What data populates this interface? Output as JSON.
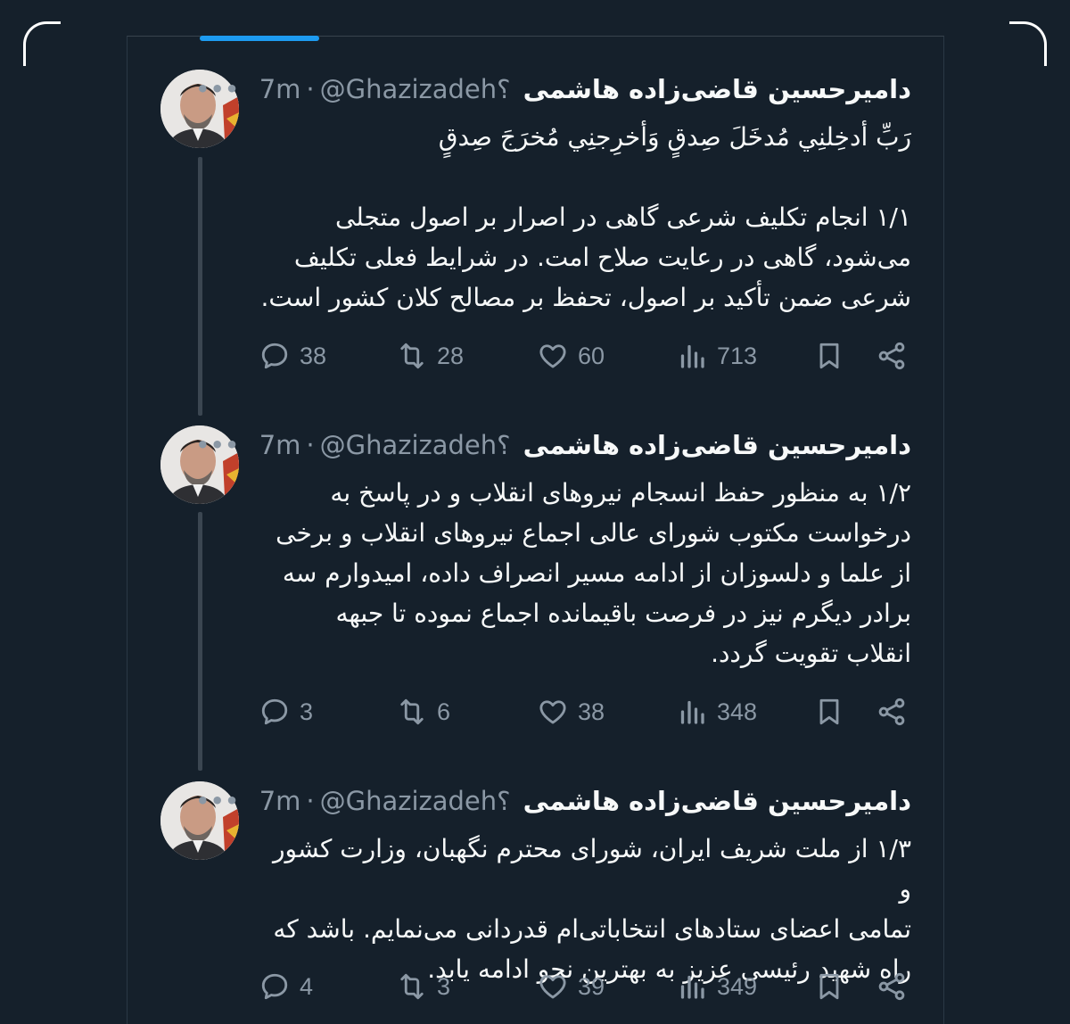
{
  "tweets": [
    {
      "name": "دامیرحسین قاضی‌زاده هاشمی",
      "handle": "@Ghazizadeh؟",
      "time": "7m",
      "more": "•••",
      "lines": [
        "رَبِّ أدخِلنِي مُدخَلَ صِدقٍ وَأخرِجنِي مُخرَجَ صِدقٍ",
        "",
        "۱/۱ انجام تکلیف شرعی گاهی در اصرار بر اصول متجلی",
        "می‌شود، گاهی در رعایت صلاح امت. در شرایط فعلی تکلیف",
        "شرعی ضمن تأکید بر اصول، تحفظ بر مصالح کلان کشور است."
      ],
      "replies": "38",
      "retweets": "28",
      "likes": "60",
      "views": "713"
    },
    {
      "name": "دامیرحسین قاضی‌زاده هاشمی",
      "handle": "@Ghazizadeh؟",
      "time": "7m",
      "more": "•••",
      "lines": [
        "۱/۲ به منظور حفظ انسجام نیروهای انقلاب و در پاسخ به",
        "درخواست مکتوب شورای عالی اجماع نیروهای انقلاب و برخی",
        "از علما و دلسوزان از ادامه مسیر انصراف داده، امیدوارم سه",
        "برادر دیگرم نیز در فرصت باقیمانده اجماع نموده تا جبهه",
        "انقلاب تقویت گردد."
      ],
      "replies": "3",
      "retweets": "6",
      "likes": "38",
      "views": "348"
    },
    {
      "name": "دامیرحسین قاضی‌زاده هاشمی",
      "handle": "@Ghazizadeh؟",
      "time": "7m",
      "more": "•••",
      "lines": [
        "۱/۳ از ملت شریف ایران، شورای محترم نگهبان، وزارت کشور و",
        "تمامی اعضای ستادهای انتخاباتی‌ام قدردانی می‌نمایم. باشد که",
        "راه شهید رئیسی عزیز به بهترین نحو ادامه یابد."
      ],
      "replies": "4",
      "retweets": "3",
      "likes": "39",
      "views": "349"
    }
  ],
  "colors": {
    "background": "#15202b",
    "text": "#f7f9f9",
    "muted": "#8b98a5",
    "accent": "#1d9bf0",
    "thread": "#3b4651"
  },
  "icons": [
    "reply-icon",
    "retweet-icon",
    "like-icon",
    "views-icon",
    "bookmark-icon",
    "share-icon"
  ]
}
